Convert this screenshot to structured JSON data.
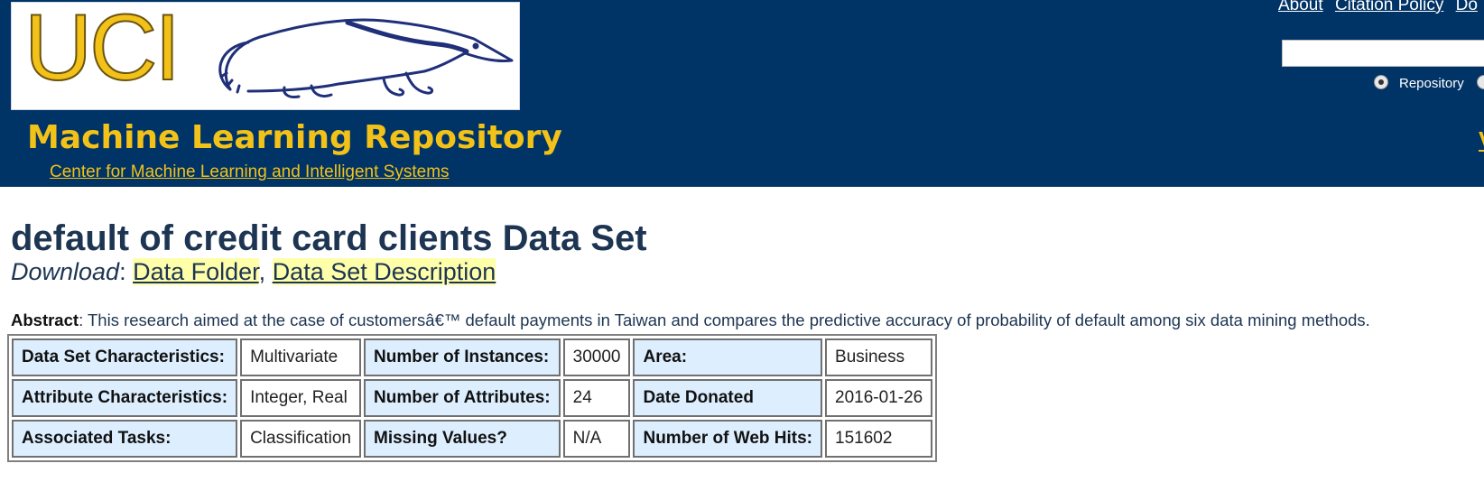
{
  "header": {
    "logo_text": "UCI",
    "site_title": "Machine Learning Repository",
    "center_link": "Center for Machine Learning and Intelligent Systems",
    "nav": [
      "About",
      "Citation Policy",
      "Do"
    ],
    "search_placeholder": "",
    "radio_repository_label": "Repository",
    "right_fragment": "V",
    "colors": {
      "header_bg": "#003366",
      "accent": "#f2c218"
    }
  },
  "dataset": {
    "title": "default of credit card clients Data Set",
    "download_label": "Download",
    "download_links": [
      "Data Folder",
      "Data Set Description"
    ],
    "abstract_label": "Abstract",
    "abstract_text": ": This research aimed at the case of customersâ€™ default payments in Taiwan and compares the predictive accuracy of probability of default among six data mining methods."
  },
  "table": {
    "rows": [
      [
        "Data Set Characteristics:",
        "Multivariate",
        "Number of Instances:",
        "30000",
        "Area:",
        "Business"
      ],
      [
        "Attribute Characteristics:",
        "Integer, Real",
        "Number of Attributes:",
        "24",
        "Date Donated",
        "2016-01-26"
      ],
      [
        "Associated Tasks:",
        "Classification",
        "Missing Values?",
        "N/A",
        "Number of Web Hits:",
        "151602"
      ]
    ]
  }
}
